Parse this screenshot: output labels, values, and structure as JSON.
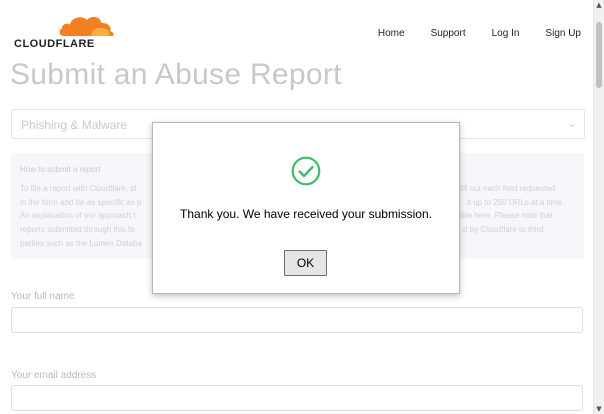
{
  "header": {
    "logo_text": "CLOUDFLARE",
    "logo_color": "#f38020",
    "nav": [
      "Home",
      "Support",
      "Log In",
      "Sign Up"
    ]
  },
  "main": {
    "title": "Submit an Abuse Report",
    "report_type": {
      "selected": "Phishing & Malware",
      "icon": "chevron-down-icon"
    },
    "info_box": {
      "title": "How to submit a report",
      "lines_left": [
        "To file a report with Cloudflare, pl",
        "in the form and be as specific as p",
        "An explanation of our approach t",
        "reports submitted through this fo",
        "parties such as the Lumen Databa"
      ],
      "lines_right": [
        "fill out each field requested",
        "it up to 250 URLs at a time.",
        "able here. Please note that",
        "d by Cloudflare to third"
      ]
    },
    "fields": [
      {
        "label": "Your full name",
        "value": ""
      },
      {
        "label": "Your email address",
        "value": ""
      }
    ]
  },
  "dialog": {
    "icon": "check-circle-icon",
    "icon_color": "#3dbb6a",
    "message": "Thank you. We have received your submission.",
    "ok_label": "OK"
  },
  "scrollbar": {
    "up_icon": "scroll-up-arrow-icon",
    "down_icon": "scroll-down-arrow-icon"
  }
}
